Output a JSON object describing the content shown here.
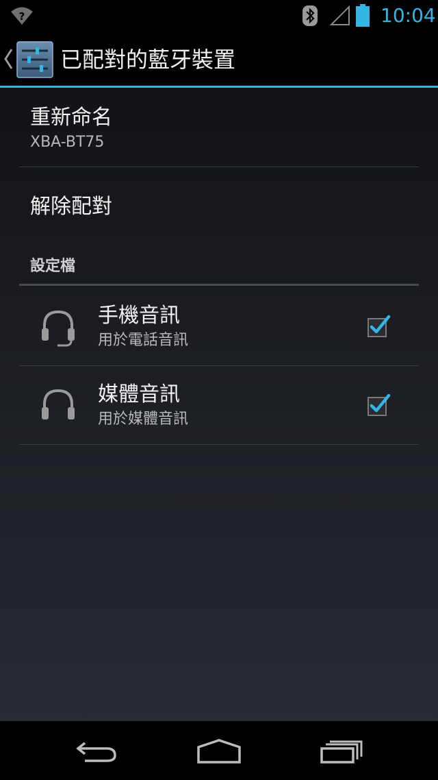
{
  "status_bar": {
    "time": "10:04",
    "icons": [
      "wifi-unknown-icon",
      "bluetooth-icon",
      "signal-icon",
      "battery-icon"
    ],
    "accent_color": "#33b5e5"
  },
  "action_bar": {
    "title": "已配對的藍牙裝置",
    "icons": [
      "up-caret-icon",
      "settings-app-icon"
    ]
  },
  "settings": {
    "rename": {
      "title": "重新命名",
      "value": "XBA-BT75"
    },
    "unpair": {
      "title": "解除配對"
    },
    "profiles_header": "設定檔",
    "profiles": [
      {
        "title": "手機音訊",
        "summary": "用於電話音訊",
        "icon": "headset-mic-icon",
        "checked": true
      },
      {
        "title": "媒體音訊",
        "summary": "用於媒體音訊",
        "icon": "headphones-icon",
        "checked": true
      }
    ]
  },
  "nav_bar": {
    "buttons": [
      "back-icon",
      "home-icon",
      "recent-apps-icon"
    ]
  }
}
